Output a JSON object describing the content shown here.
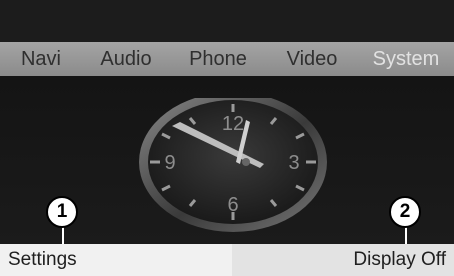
{
  "menu": {
    "items": [
      {
        "label": "Navi"
      },
      {
        "label": "Audio"
      },
      {
        "label": "Phone"
      },
      {
        "label": "Video"
      },
      {
        "label": "System"
      }
    ],
    "active": "System"
  },
  "clock": {
    "numerals": [
      "12",
      "3",
      "6",
      "9"
    ]
  },
  "softkeys": {
    "left": "Settings",
    "right": "Display Off"
  },
  "callouts": [
    "1",
    "2"
  ],
  "colors": {
    "menu_bar": "#9a9a9a",
    "active_menu_text": "#e2e2e2",
    "screen_background": "#161616"
  }
}
